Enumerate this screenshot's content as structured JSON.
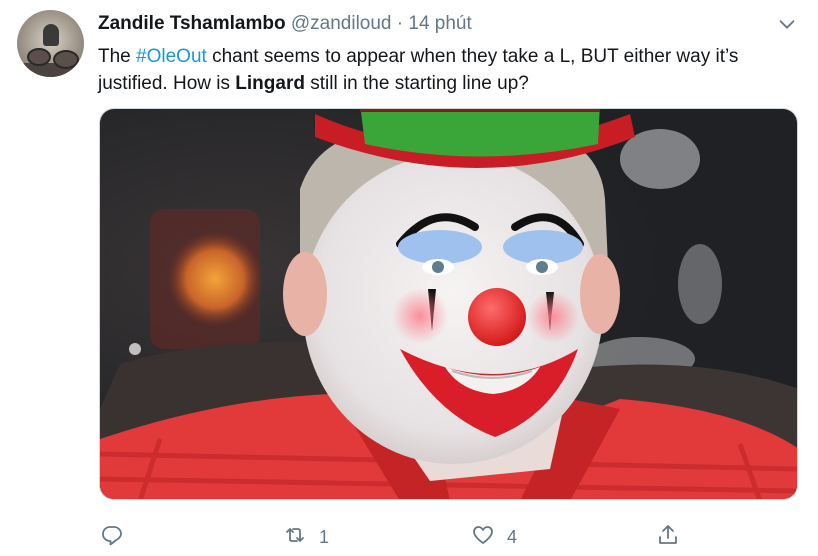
{
  "tweet": {
    "author_name": "Zandile Tshamlambo",
    "handle": "@zandiloud",
    "separator": "·",
    "time": "14 phút",
    "text_part1": "The ",
    "hashtag": "#OleOut",
    "text_part2": " chant seems to appear when they take a L, BUT either way it’s justified. How is ",
    "bold_word": "Lingard",
    "text_part3": " still in the starting line up?"
  },
  "actions": {
    "reply_count": "",
    "retweet_count": "1",
    "like_count": "4"
  },
  "icons": {
    "menu": "chevron-down-icon",
    "reply": "reply-icon",
    "retweet": "retweet-icon",
    "like": "heart-icon",
    "share": "share-icon"
  },
  "colors": {
    "link": "#1b95e0",
    "muted": "#657786",
    "text": "#14171a"
  }
}
